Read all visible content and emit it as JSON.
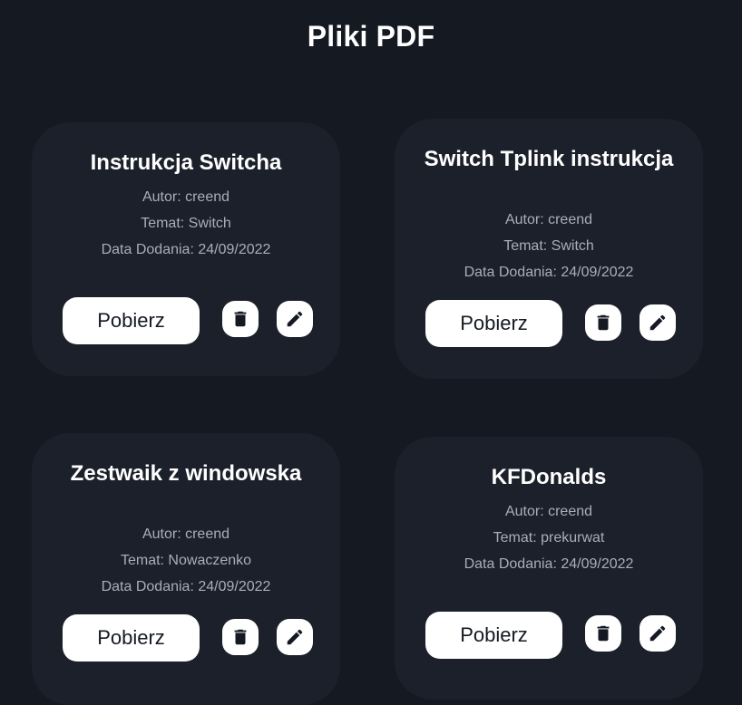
{
  "page": {
    "title": "Pliki PDF"
  },
  "colors": {
    "background": "#141922",
    "card": "#1b202b",
    "meta_text": "#a7afbb",
    "button": "#ffffff",
    "button_text": "#141922"
  },
  "cards": [
    {
      "title": "Instrukcja Switcha",
      "author": "Autor: creend",
      "topic": "Temat: Switch",
      "date": "Data Dodania: 24/09/2022",
      "download_label": "Pobierz",
      "delete_icon": "trash-icon",
      "edit_icon": "pencil-icon"
    },
    {
      "title": "Switch Tplink instrukcja",
      "author": "Autor: creend",
      "topic": "Temat: Switch",
      "date": "Data Dodania: 24/09/2022",
      "download_label": "Pobierz",
      "delete_icon": "trash-icon",
      "edit_icon": "pencil-icon"
    },
    {
      "title": "Zestwaik z windowska",
      "author": "Autor: creend",
      "topic": "Temat: Nowaczenko",
      "date": "Data Dodania: 24/09/2022",
      "download_label": "Pobierz",
      "delete_icon": "trash-icon",
      "edit_icon": "pencil-icon"
    },
    {
      "title": "KFDonalds",
      "author": "Autor: creend",
      "topic": "Temat: prekurwat",
      "date": "Data Dodania: 24/09/2022",
      "download_label": "Pobierz",
      "delete_icon": "trash-icon",
      "edit_icon": "pencil-icon"
    }
  ]
}
